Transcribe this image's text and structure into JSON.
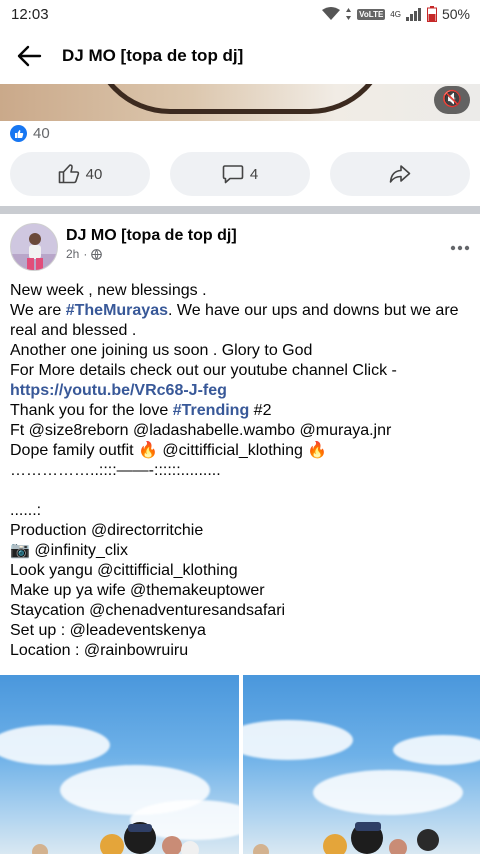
{
  "status_bar": {
    "time": "12:03",
    "network_badge": "VoLTE",
    "network_type": "4G",
    "battery": "50%"
  },
  "app_bar": {
    "title": "DJ MO [topa de top dj]"
  },
  "reactions": {
    "like_count": "40"
  },
  "action_row": {
    "like_count": "40",
    "comment_count": "4"
  },
  "post": {
    "author": "DJ MO [topa de top dj]",
    "time": "2h",
    "separator": "·",
    "lines": {
      "l1": "New week , new blessings .",
      "l2_pre": "We are ",
      "l2_tag": "#TheMurayas",
      "l2_post": ". We have our ups and downs but we are real and blessed .",
      "l3": "Another one joining us soon . Glory to God",
      "l4": "For More details check out our youtube channel Click -",
      "l5_link": "https://youtu.be/VRc68-J-feg",
      "l6_pre": "Thank you for the love ",
      "l6_tag": "#Trending",
      "l6_post": " #2",
      "l7": "Ft @size8reborn @ladashabelle.wambo @muraya.jnr",
      "l8_pre": "Dope family outfit ",
      "l8_emoji": "🔥",
      "l8_mid": " @cittifficial_klothing ",
      "l8_emoji2": "🔥",
      "l9": "……………..::::——-::::::.........",
      "l10": " ",
      "l11": "......:",
      "l12": "Production @directorritchie",
      "l13_emoji": "📷",
      "l13": " @infinity_clix",
      "l14": "Look yangu @cittifficial_klothing",
      "l15": "Make up ya wife @themakeuptower",
      "l16": "Staycation @chenadventuresandsafari",
      "l17": "Set up : @leadeventskenya",
      "l18": "Location : @rainbowruiru"
    }
  },
  "colors": {
    "accent_link": "#385898",
    "like_blue": "#1877f2",
    "button_bg": "#eff1f4",
    "divider": "#c9ccd1"
  },
  "icons": {
    "back": "arrow-left-icon",
    "mute": "speaker-mute-icon",
    "like": "thumbs-up-icon",
    "comment": "speech-bubble-icon",
    "share": "share-arrow-icon",
    "more": "more-dots-icon",
    "privacy": "globe-icon"
  }
}
